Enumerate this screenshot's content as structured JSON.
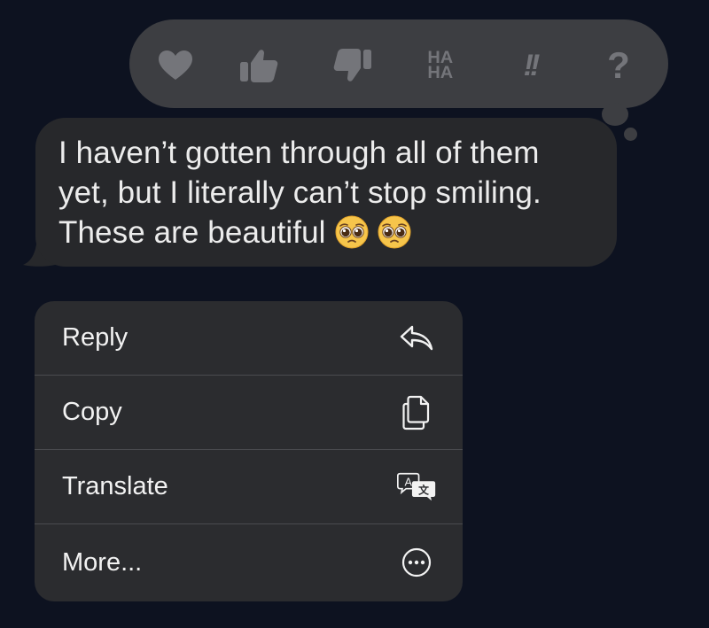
{
  "tapback": {
    "reactions": [
      {
        "name": "heart",
        "icon": "heart-icon"
      },
      {
        "name": "thumbs-up",
        "icon": "thumbs-up-icon"
      },
      {
        "name": "thumbs-down",
        "icon": "thumbs-down-icon"
      },
      {
        "name": "haha",
        "label_line1": "HA",
        "label_line2": "HA"
      },
      {
        "name": "emphasize",
        "label": "!!"
      },
      {
        "name": "question",
        "label": "?"
      }
    ],
    "colors": {
      "bar": "#3d3e42",
      "icon": "#74757a"
    }
  },
  "message": {
    "text_line1": "I haven’t gotten through all of them",
    "text_line2": "yet, but I literally can’t stop smiling.",
    "text_line3": "These are beautiful",
    "emojis": [
      "pleading-face-emoji",
      "pleading-face-emoji"
    ],
    "bubble_color": "#27282b"
  },
  "menu": {
    "items": [
      {
        "label": "Reply",
        "icon": "reply-icon"
      },
      {
        "label": "Copy",
        "icon": "copy-icon"
      },
      {
        "label": "Translate",
        "icon": "translate-icon"
      },
      {
        "label": "More...",
        "icon": "more-icon"
      }
    ],
    "background": "#2b2c2f"
  },
  "colors": {
    "background": "#0d1220",
    "text": "#ececec"
  }
}
